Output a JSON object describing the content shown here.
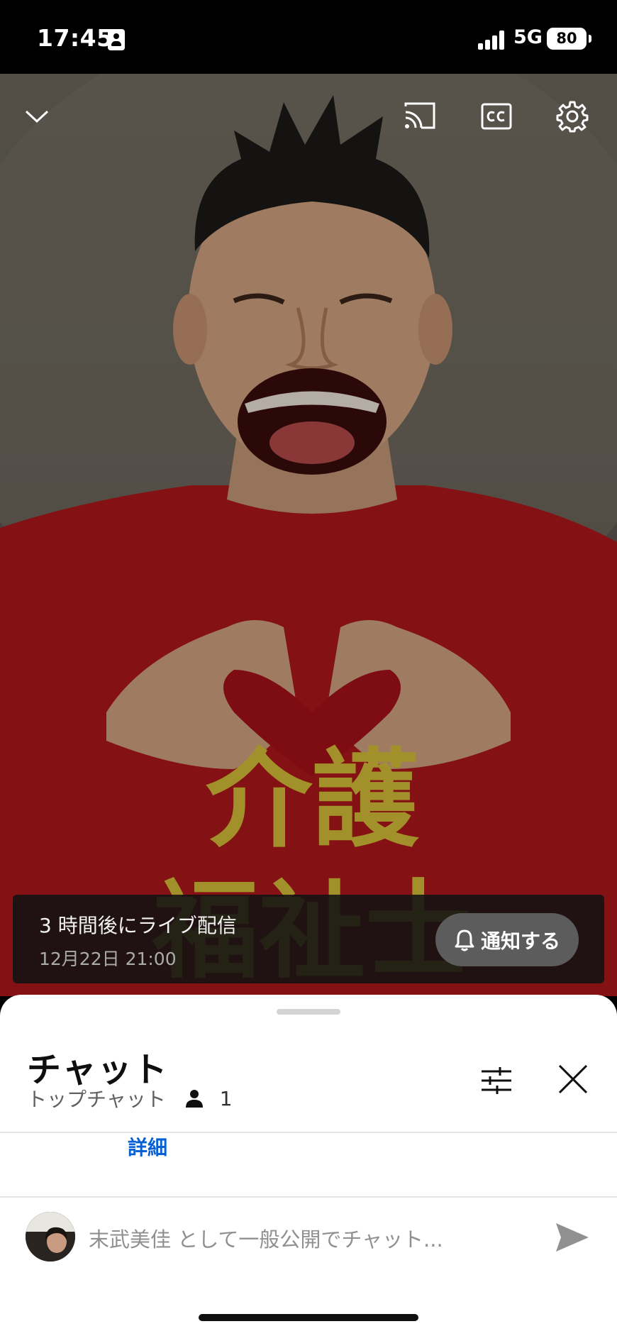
{
  "status_bar": {
    "time": "17:45",
    "network": "5G",
    "battery": "80"
  },
  "video": {
    "shirt_text_line1": "介護",
    "shirt_text_line2": "福祉士",
    "live": {
      "title": "3 時間後にライブ配信",
      "date": "12月22日 21:00",
      "notify_label": "通知する"
    }
  },
  "chat": {
    "title": "チャット",
    "mode": "トップチャット",
    "viewer_count": "1",
    "details_link": "詳細",
    "input_placeholder": "末武美佳 として一般公開でチャット..."
  },
  "colors": {
    "link": "#065fd4",
    "shirt": "#b0171a",
    "shirt_print": "#d9c23a"
  }
}
